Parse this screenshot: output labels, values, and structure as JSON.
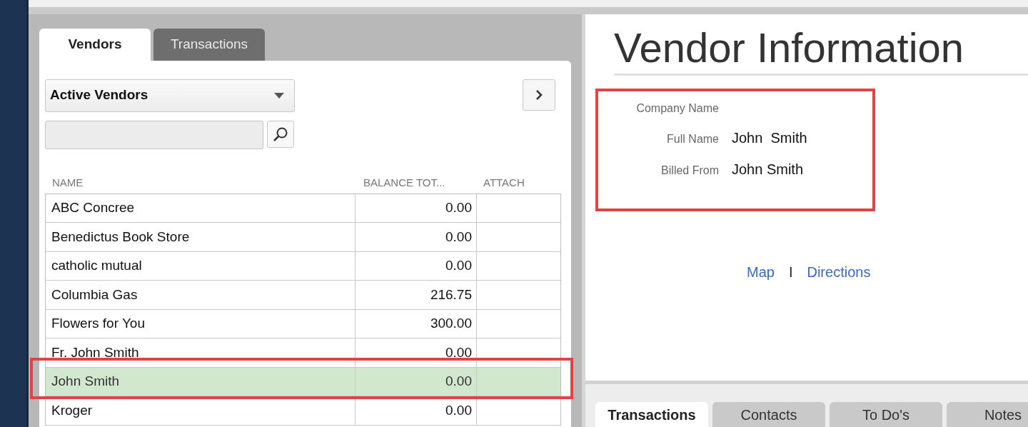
{
  "left_tabs": [
    {
      "label": "Vendors",
      "selected": true
    },
    {
      "label": "Transactions",
      "selected": false
    }
  ],
  "filter": {
    "value": "Active Vendors"
  },
  "table": {
    "columns": [
      "NAME",
      "BALANCE TOT...",
      "ATTACH"
    ],
    "rows": [
      {
        "name": "ABC Concree",
        "balance": "0.00",
        "selected": false,
        "framed": false
      },
      {
        "name": "Benedictus Book Store",
        "balance": "0.00",
        "selected": false,
        "framed": false
      },
      {
        "name": "catholic mutual",
        "balance": "0.00",
        "selected": false,
        "framed": false
      },
      {
        "name": "Columbia Gas",
        "balance": "216.75",
        "selected": false,
        "framed": false
      },
      {
        "name": "Flowers for You",
        "balance": "300.00",
        "selected": false,
        "framed": false
      },
      {
        "name": "Fr. John Smith",
        "balance": "0.00",
        "selected": false,
        "framed": false
      },
      {
        "name": "John Smith",
        "balance": "0.00",
        "selected": true,
        "framed": true
      },
      {
        "name": "Kroger",
        "balance": "0.00",
        "selected": false,
        "framed": false
      }
    ]
  },
  "info": {
    "title": "Vendor Information",
    "framed": true,
    "fields": [
      {
        "label": "Company Name"
      },
      {
        "label": "Full Name",
        "value": "John  Smith"
      },
      {
        "label": "Billed From",
        "value": "John Smith"
      }
    ],
    "links": [
      "Map",
      "Directions"
    ],
    "separator": "I"
  },
  "bottom_tabs": [
    {
      "label": "Transactions",
      "selected": true
    },
    {
      "label": "Contacts",
      "selected": false
    },
    {
      "label": "To Do's",
      "selected": false
    },
    {
      "label": "Notes",
      "selected": false
    }
  ]
}
